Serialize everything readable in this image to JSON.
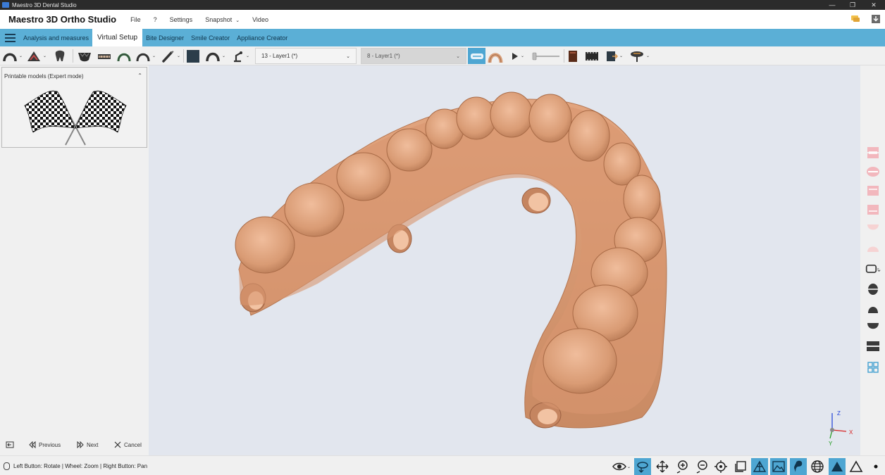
{
  "window": {
    "title": "Maestro 3D Dental Studio",
    "controls": [
      "—",
      "❐",
      "✕"
    ]
  },
  "menubar": {
    "brand": "Maestro 3D Ortho Studio",
    "items": [
      "File",
      "?",
      "Settings",
      "Snapshot",
      "Video"
    ],
    "snapshot_has_dropdown": true
  },
  "tabs": [
    {
      "label": "Analysis and measures",
      "active": false
    },
    {
      "label": "Virtual Setup",
      "active": true
    },
    {
      "label": "Bite Designer",
      "active": false
    },
    {
      "label": "Smile Creator",
      "active": false
    },
    {
      "label": "Appliance Creator",
      "active": false
    }
  ],
  "toolbar": {
    "layer_combo": "13 - Layer1 (*)",
    "layer_combo_disabled": "8 - Layer1 (*)",
    "icons": [
      "arch-icon",
      "gum-icon",
      "tooth-icon",
      "upper-jaw-icon",
      "ruler-jaw-icon",
      "arch-line-icon",
      "arch-wire-icon",
      "brush-icon",
      "color-square-icon",
      "arch-outline-icon",
      "robot-arm-icon",
      "overlay-toggle-icon",
      "arch-thumbnail-icon",
      "play-icon",
      "timeline-slider",
      "report-icon",
      "film-icon",
      "export-icon",
      "tree-icon"
    ]
  },
  "left_panel": {
    "printable_title": "Printable models (Expert mode)",
    "collapse_glyph": "⌃",
    "image": "checkered-flags-icon",
    "nav": {
      "previous": "Previous",
      "next": "Next",
      "cancel": "Cancel"
    }
  },
  "status": {
    "text": "Left Button: Rotate | Wheel: Zoom | Right Button: Pan"
  },
  "axes": {
    "z": "Z",
    "x": "X",
    "y": "Y"
  },
  "colors": {
    "tab_bar": "#5bafd6",
    "viewport_bg": "#e2e6ee",
    "model": "#dc9a72",
    "active_toggle": "#4ea6d2"
  }
}
